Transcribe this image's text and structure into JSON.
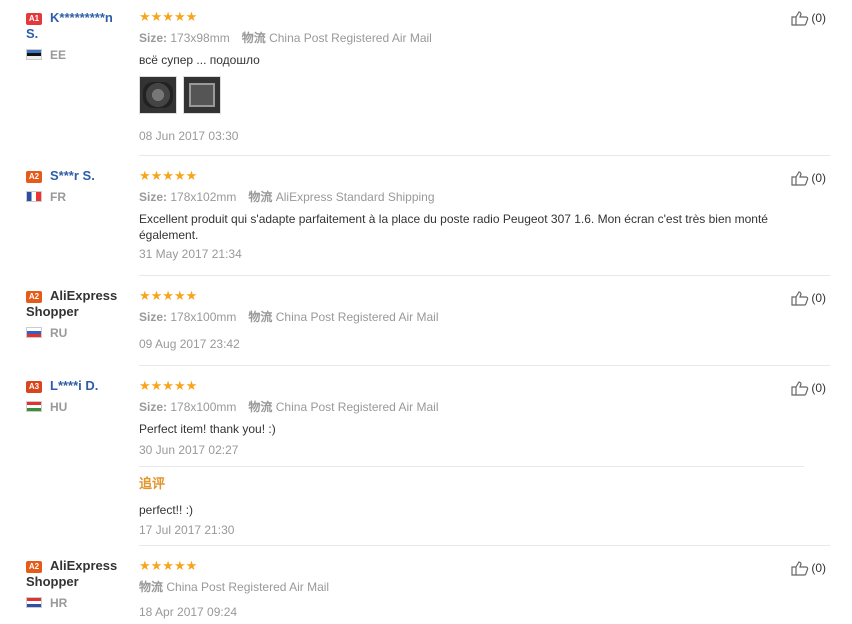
{
  "rating_stars": "★★★★★",
  "reviews": [
    {
      "level": "A1",
      "name_line1": "K*********n",
      "name_line2": "S.",
      "country": "EE",
      "size_label": "Size:",
      "size": "173x98mm",
      "logistics_label": "物流",
      "shipping": "China Post Registered Air Mail",
      "text": "всё супер ... подошло",
      "date": "08 Jun 2017 03:30",
      "helpful": "(0)"
    },
    {
      "level": "A2",
      "name_line1": "S***r S.",
      "country": "FR",
      "size_label": "Size:",
      "size": "178x102mm",
      "logistics_label": "物流",
      "shipping": "AliExpress Standard Shipping",
      "text": "Excellent produit qui s'adapte parfaitement à la place du poste radio Peugeot 307 1.6. Mon écran c'est très bien monté également.",
      "date": "31 May 2017 21:34",
      "helpful": "(0)"
    },
    {
      "level": "A2",
      "name_line1": "AliExpress",
      "name_line2": "Shopper",
      "country": "RU",
      "size_label": "Size:",
      "size": "178x100mm",
      "logistics_label": "物流",
      "shipping": "China Post Registered Air Mail",
      "date": "09 Aug 2017 23:42",
      "helpful": "(0)"
    },
    {
      "level": "A3",
      "name_line1": "L****i D.",
      "country": "HU",
      "size_label": "Size:",
      "size": "178x100mm",
      "logistics_label": "物流",
      "shipping": "China Post Registered Air Mail",
      "text": "Perfect item! thank you! :)",
      "date": "30 Jun 2017 02:27",
      "followup_label": "追评",
      "followup_text": "perfect!! :)",
      "followup_date": "17 Jul 2017 21:30",
      "helpful": "(0)"
    },
    {
      "level": "A2",
      "name_line1": "AliExpress",
      "name_line2": "Shopper",
      "country": "HR",
      "logistics_label": "物流",
      "shipping": "China Post Registered Air Mail",
      "date": "18 Apr 2017 09:24",
      "helpful": "(0)"
    }
  ],
  "icons": {
    "helpful": "thumbs-up-icon",
    "level": "level-badge",
    "country": "country-flag"
  },
  "colors": {
    "star": "#f7a51c",
    "username": "#2e5ea7",
    "followup": "#e0962d",
    "muted": "#999999"
  }
}
